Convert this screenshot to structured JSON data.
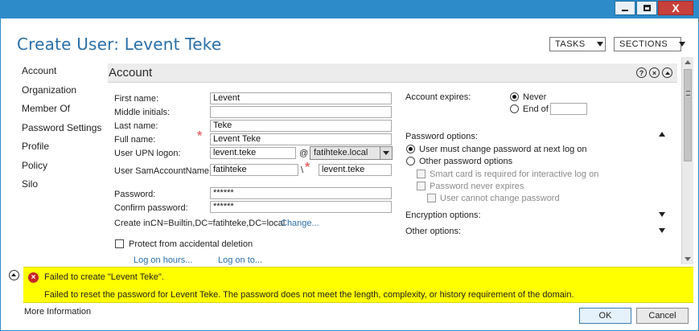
{
  "window": {
    "title": "Create User: Levent Teke",
    "tasks_label": "TASKS",
    "sections_label": "SECTIONS",
    "close_glyph": "X"
  },
  "nav": {
    "items": [
      "Account",
      "Organization",
      "Member Of",
      "Password Settings",
      "Profile",
      "Policy",
      "Silo"
    ]
  },
  "section": {
    "title": "Account",
    "help_glyph": "?",
    "close_glyph": "×"
  },
  "form": {
    "first_name_label": "First name:",
    "first_name_value": "Levent",
    "middle_initials_label": "Middle initials:",
    "middle_initials_value": "",
    "last_name_label": "Last name:",
    "last_name_value": "Teke",
    "full_name_label": "Full name:",
    "full_name_value": "Levent Teke",
    "upn_label": "User UPN logon:",
    "upn_value": "levent.teke",
    "upn_at": "@",
    "upn_domain": "fatihteke.local",
    "sam_label": "User SamAccountName l...",
    "sam_domain_value": "fatihteke",
    "sam_separator": "\\",
    "sam_user_value": "levent.teke",
    "password_label": "Password:",
    "password_value": "******",
    "confirm_password_label": "Confirm password:",
    "confirm_password_value": "******",
    "create_in_label": "Create in:",
    "create_in_value": "CN=Builtin,DC=fatihteke,DC=local",
    "change_link": "Change...",
    "protect_label": "Protect from accidental deletion",
    "protect_checked": false,
    "logon_hours_link": "Log on hours...",
    "logon_to_link": "Log on to..."
  },
  "account_expires": {
    "label": "Account expires:",
    "never_label": "Never",
    "end_of_label": "End of",
    "end_of_value": "",
    "selected": "never"
  },
  "password_options": {
    "label": "Password options:",
    "must_change_label": "User must change password at next log on",
    "other_label": "Other password options",
    "smart_card_label": "Smart card is required for interactive log on",
    "never_expires_label": "Password never expires",
    "cannot_change_label": "User cannot change password",
    "selected": "must_change"
  },
  "encryption_options": {
    "label": "Encryption options:"
  },
  "other_options": {
    "label": "Other options:"
  },
  "error": {
    "title": "Failed to create \"Levent Teke\".",
    "detail": "Failed to reset the password for Levent Teke. The password does not meet the length, complexity, or history requirement of the domain.",
    "color": "#ffff00"
  },
  "footer": {
    "more_info": "More Information",
    "ok_label": "OK",
    "cancel_label": "Cancel"
  },
  "colors": {
    "title_blue": "#2b6fa8",
    "chrome_blue": "#2e8bc9",
    "required_star": "#e46b6b",
    "error_red": "#c42626"
  }
}
